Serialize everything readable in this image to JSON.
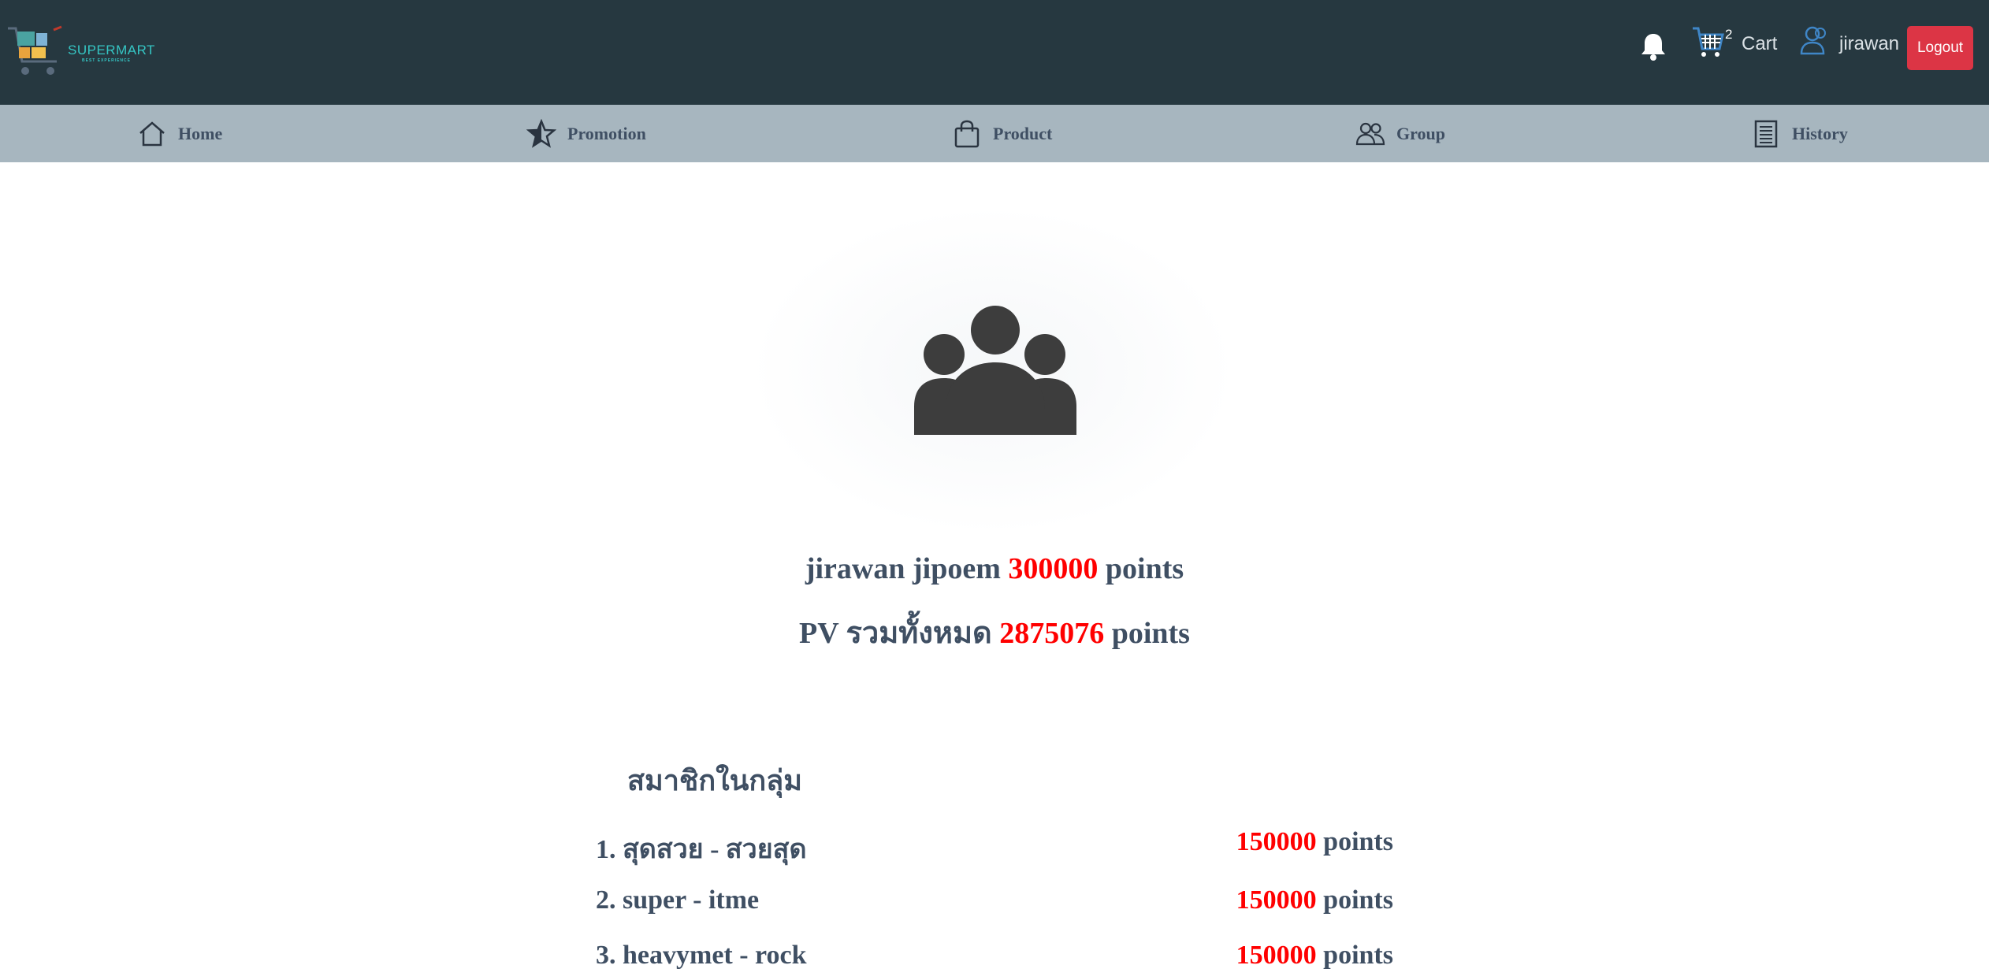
{
  "header": {
    "brand": "SUPERMART",
    "brand_tagline": "BEST EXPERIENCE",
    "cart_count": "2",
    "cart_label": "Cart",
    "username": "jirawan",
    "logout_label": "Logout"
  },
  "nav": {
    "items": [
      {
        "label": "Home",
        "icon": "home-icon"
      },
      {
        "label": "Promotion",
        "icon": "star-icon"
      },
      {
        "label": "Product",
        "icon": "shopping-bag-icon"
      },
      {
        "label": "Group",
        "icon": "people-icon"
      },
      {
        "label": "History",
        "icon": "receipt-icon"
      }
    ]
  },
  "summary": {
    "full_name": "jirawan jipoem",
    "points": "300000",
    "points_unit": "points",
    "pv_label": "PV รวมทั้งหมด",
    "pv_total": "2875076",
    "pv_unit": "points"
  },
  "members": {
    "title": "สมาชิกในกลุ่ม",
    "unit": "points",
    "list": [
      {
        "name": "1. สุดสวย - สวยสุด",
        "points": "150000"
      },
      {
        "name": "2. super - itme",
        "points": "150000"
      },
      {
        "name": "3. heavymet - rock",
        "points": "150000"
      }
    ]
  },
  "colors": {
    "header_bg": "#263840",
    "nav_bg": "#a7b6bf",
    "text": "#3f4f63",
    "accent_red": "#ff0000",
    "logout_bg": "#dc3545"
  }
}
